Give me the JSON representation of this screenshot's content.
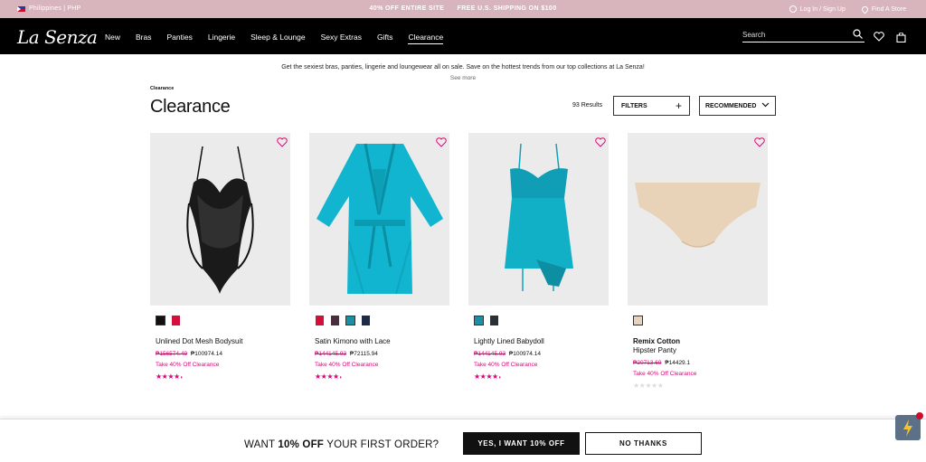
{
  "promo_bar": {
    "region": "Philippines | PHP",
    "offers": [
      "40% OFF ENTIRE SITE",
      "FREE U.S. SHIPPING ON $100"
    ],
    "login": "Log In / Sign Up",
    "store": "Find A Store"
  },
  "nav": {
    "logo": "La Senza",
    "items": [
      "New",
      "Bras",
      "Panties",
      "Lingerie",
      "Sleep & Lounge",
      "Sexy Extras",
      "Gifts",
      "Clearance"
    ],
    "active": "Clearance",
    "search_placeholder": "Search"
  },
  "banner": {
    "text": "Get the sexiest bras, panties, lingerie and loungewear all on sale. Save on the hottest trends from our top collections at La Senza!",
    "see_more": "See more"
  },
  "breadcrumb": "Clearance",
  "page_title": "Clearance",
  "results": "93 Results",
  "filters_label": "FILTERS",
  "sort_label": "RECOMMENDED",
  "colors": {
    "accent": "#e0007a",
    "promo_bg": "#d8b4bd",
    "nav_bg": "#000000"
  },
  "products": [
    {
      "name": "Unlined Dot Mesh Bodysuit",
      "subtitle": "",
      "old_price": "₱156574.49",
      "price": "₱100974.14",
      "promo": "Take 40% Off Clearance",
      "rating": 4.5,
      "swatches": [
        "#111111",
        "#d40f3a"
      ]
    },
    {
      "name": "Satin Kimono with Lace",
      "subtitle": "",
      "old_price": "₱144145.93",
      "price": "₱72115.94",
      "promo": "Take 40% Off Clearance",
      "rating": 4.5,
      "swatches": [
        "#d40f3a",
        "#4a2e3e",
        "#1b8fa6",
        "#1f2a44"
      ]
    },
    {
      "name": "Lightly Lined Babydoll",
      "subtitle": "",
      "old_price": "₱144145.93",
      "price": "₱100974.14",
      "promo": "Take 40% Off Clearance",
      "rating": 4.5,
      "swatches": [
        "#1b8fa6",
        "#2b2f36"
      ]
    },
    {
      "name": "Remix Cotton",
      "subtitle": "Hipster Panty",
      "old_price": "₱20713.69",
      "price": "₱14429.1",
      "promo": "Take 40% Off Clearance",
      "rating": 0,
      "swatches": [
        "#e6d3bd"
      ]
    }
  ],
  "popup": {
    "text_pre": "WANT ",
    "text_bold": "10% OFF",
    "text_post": " YOUR FIRST ORDER?",
    "yes": "YES, I WANT 10% OFF",
    "no": "NO THANKS"
  }
}
